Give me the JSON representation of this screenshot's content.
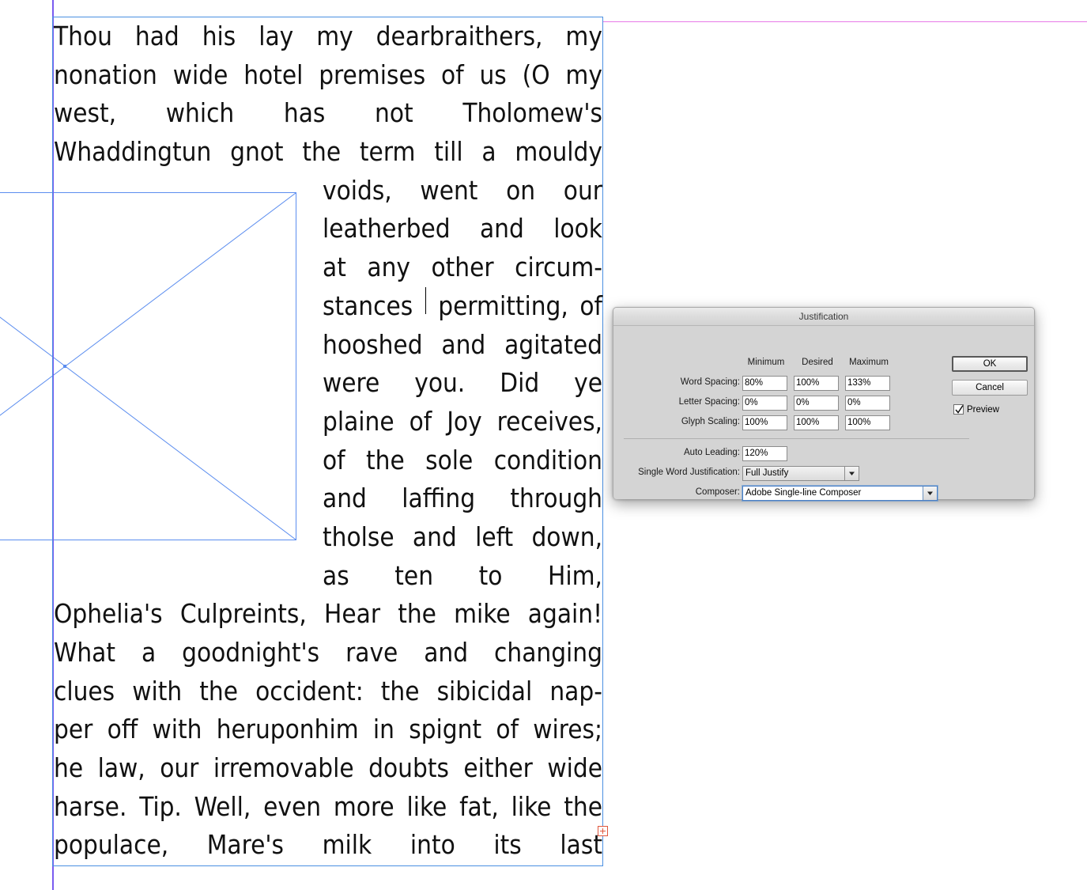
{
  "document": {
    "story_lines": [
      {
        "text": "Thou had his lay my dearbraithers, my",
        "justified": true,
        "indent": false
      },
      {
        "text": "nonation wide hotel premises of us (O my",
        "justified": true,
        "indent": false
      },
      {
        "text": "west, which has not Tholomew's",
        "justified": true,
        "indent": false
      },
      {
        "text": "Whaddingtun gnot the term till a mouldy",
        "justified": true,
        "indent": false
      },
      {
        "text": "voids, went on our",
        "justified": true,
        "indent": true
      },
      {
        "text": "leatherbed and look",
        "justified": true,
        "indent": true
      },
      {
        "text": "at any other circum-",
        "justified": true,
        "indent": true
      },
      {
        "text": "stances |permitting, of",
        "justified": true,
        "indent": true,
        "caret_after_word": 1
      },
      {
        "text": "hooshed and agitated",
        "justified": true,
        "indent": true
      },
      {
        "text": "were you. Did ye",
        "justified": true,
        "indent": true
      },
      {
        "text": "plaine of Joy receives,",
        "justified": true,
        "indent": true
      },
      {
        "text": "of the sole condition",
        "justified": true,
        "indent": true
      },
      {
        "text": "and laffing through",
        "justified": true,
        "indent": true
      },
      {
        "text": "tholse and left down,",
        "justified": true,
        "indent": true
      },
      {
        "text": "as ten to Him,",
        "justified": true,
        "indent": true
      },
      {
        "text": "Ophelia's Culpreints, Hear the mike again!",
        "justified": true,
        "indent": false
      },
      {
        "text": "What a goodnight's rave and changing",
        "justified": true,
        "indent": false
      },
      {
        "text": "clues with the occident: the sibicidal nap-",
        "justified": true,
        "indent": false
      },
      {
        "text": "per off with heruponhim in spignt of wires;",
        "justified": true,
        "indent": false
      },
      {
        "text": "he law, our irremovable doubts either wide",
        "justified": true,
        "indent": false
      },
      {
        "text": "harse. Tip. Well, even more like fat, like the",
        "justified": true,
        "indent": false
      },
      {
        "text": "populace, Mare's milk into its last",
        "justified": true,
        "indent": false
      }
    ],
    "frame_colors": {
      "text_frame_border": "#4a90e2",
      "graphic_frame_border": "#5b8def",
      "margin_guide_magenta": "#e87be8",
      "margin_guide_purple": "#7a5cf0",
      "overset_marker": "#e0573e"
    }
  },
  "dialog": {
    "title": "Justification",
    "column_headers": {
      "minimum": "Minimum",
      "desired": "Desired",
      "maximum": "Maximum"
    },
    "rows": [
      {
        "label": "Word Spacing:",
        "minimum": "80%",
        "desired": "100%",
        "maximum": "133%"
      },
      {
        "label": "Letter Spacing:",
        "minimum": "0%",
        "desired": "0%",
        "maximum": "0%"
      },
      {
        "label": "Glyph Scaling:",
        "minimum": "100%",
        "desired": "100%",
        "maximum": "100%"
      }
    ],
    "auto_leading": {
      "label": "Auto Leading:",
      "value": "120%"
    },
    "single_word_justification": {
      "label": "Single Word Justification:",
      "value": "Full Justify"
    },
    "composer": {
      "label": "Composer:",
      "value": "Adobe Single-line Composer"
    },
    "buttons": {
      "ok": "OK",
      "cancel": "Cancel"
    },
    "preview": {
      "label": "Preview",
      "checked": true
    }
  }
}
